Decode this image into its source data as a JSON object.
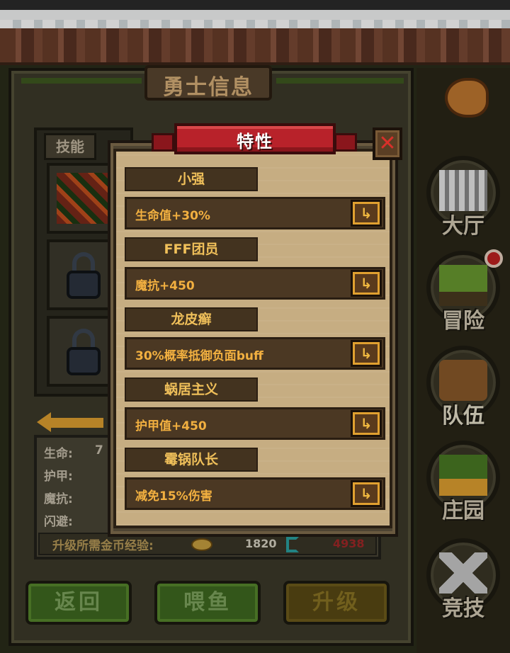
{
  "screen_title": "勇士信息",
  "skills": {
    "tab_label": "技能"
  },
  "stats": {
    "hp_label": "生命:",
    "armor_label": "护甲:",
    "magic_resist_label": "魔抗:",
    "dodge_label": "闪避:",
    "hp_value_partial": "7",
    "upgrade_cost_label": "升级所需金币经验:",
    "gold_cost": "1820",
    "exp_cost": "4938"
  },
  "buttons": {
    "back": "返回",
    "feed": "喂鱼",
    "upgrade": "升级"
  },
  "side_nav": [
    {
      "label": "大厅",
      "icon": "hall-icon"
    },
    {
      "label": "冒险",
      "icon": "adventure-icon"
    },
    {
      "label": "队伍",
      "icon": "team-icon"
    },
    {
      "label": "庄园",
      "icon": "manor-icon"
    },
    {
      "label": "竞技",
      "icon": "arena-icon"
    }
  ],
  "modal": {
    "title": "特性",
    "close_symbol": "✕",
    "traits": [
      {
        "name": "小强",
        "description": "生命值+30%"
      },
      {
        "name": "FFF团员",
        "description": "魔抗+450"
      },
      {
        "name": "龙皮癣",
        "description": "30%概率抵御负面buff"
      },
      {
        "name": "蜗居主义",
        "description": "护甲值+450"
      },
      {
        "name": "霉锅队长",
        "description": "减免15%伤害"
      }
    ]
  },
  "colors": {
    "accent_gold": "#f0c05a",
    "ribbon_red": "#b8222a",
    "panel_parchment": "#c6ad82"
  }
}
